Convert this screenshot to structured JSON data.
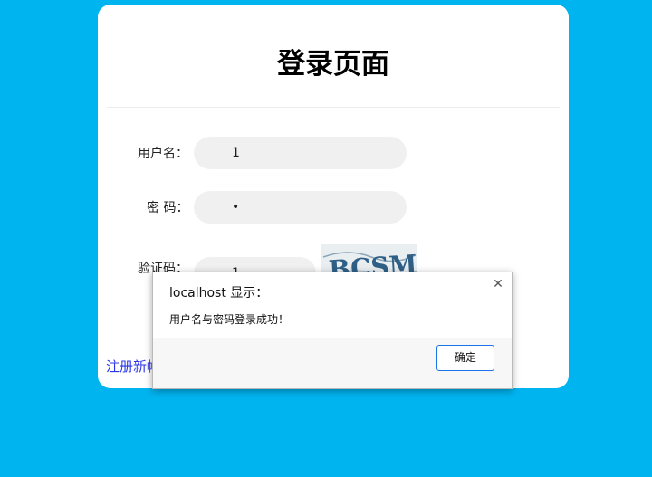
{
  "login": {
    "title": "登录页面",
    "username_label": "用户名：",
    "username_value": "1",
    "password_label": "密 码：",
    "password_value": "•",
    "captcha_label": "验证码：",
    "captcha_value": "1",
    "captcha_image_text": "BCSM",
    "register_link": "注册新帐号"
  },
  "dialog": {
    "title": "localhost 显示：",
    "message": "用户名与密码登录成功！",
    "ok_label": "确定",
    "close_icon": "close-icon"
  },
  "colors": {
    "background": "#00b4f0",
    "card": "#ffffff",
    "field": "#f0f0f0",
    "link": "#2b35e8",
    "button_border": "#1a73e8"
  }
}
